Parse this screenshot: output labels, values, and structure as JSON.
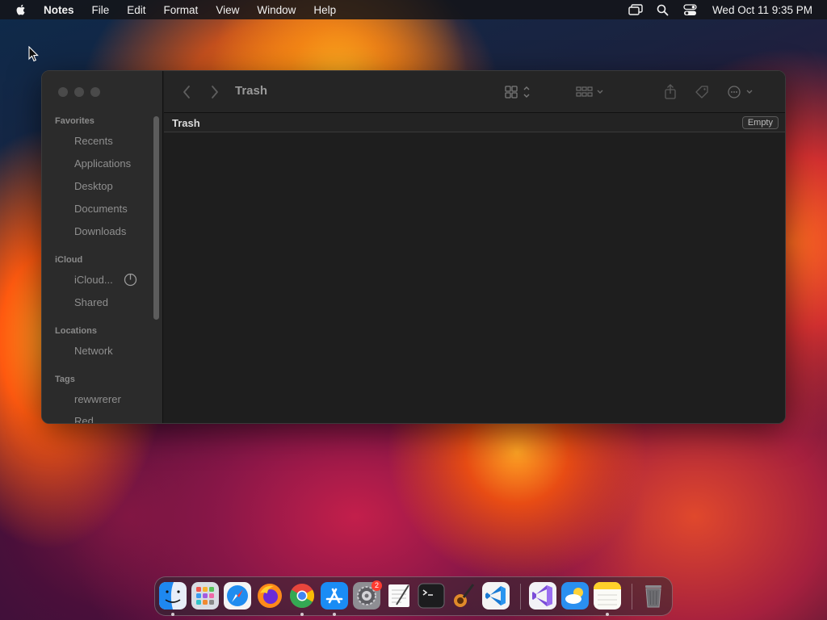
{
  "menubar": {
    "app_name": "Notes",
    "menus": [
      "File",
      "Edit",
      "Format",
      "View",
      "Window",
      "Help"
    ],
    "clock": "Wed Oct 11  9:35 PM"
  },
  "window": {
    "title": "Trash",
    "path_title": "Trash",
    "empty_button": "Empty"
  },
  "sidebar": {
    "favorites_header": "Favorites",
    "favorites": [
      "Recents",
      "Applications",
      "Desktop",
      "Documents",
      "Downloads"
    ],
    "icloud_header": "iCloud",
    "icloud": [
      "iCloud...",
      "Shared"
    ],
    "locations_header": "Locations",
    "locations": [
      "Network"
    ],
    "tags_header": "Tags",
    "tags": [
      "rewwrerer",
      "Red"
    ]
  },
  "dock": {
    "apps": [
      "finder",
      "launchpad",
      "safari",
      "firefox",
      "chrome",
      "app-store",
      "system-settings",
      "textedit",
      "terminal",
      "garageband",
      "vscode",
      "visual-studio",
      "weather",
      "notes",
      "trash"
    ],
    "settings_badge": "2"
  },
  "colors": {
    "window_bg": "#1e1e1e",
    "sidebar_bg": "#2b2b2b",
    "badge_red": "#ff3b30"
  }
}
